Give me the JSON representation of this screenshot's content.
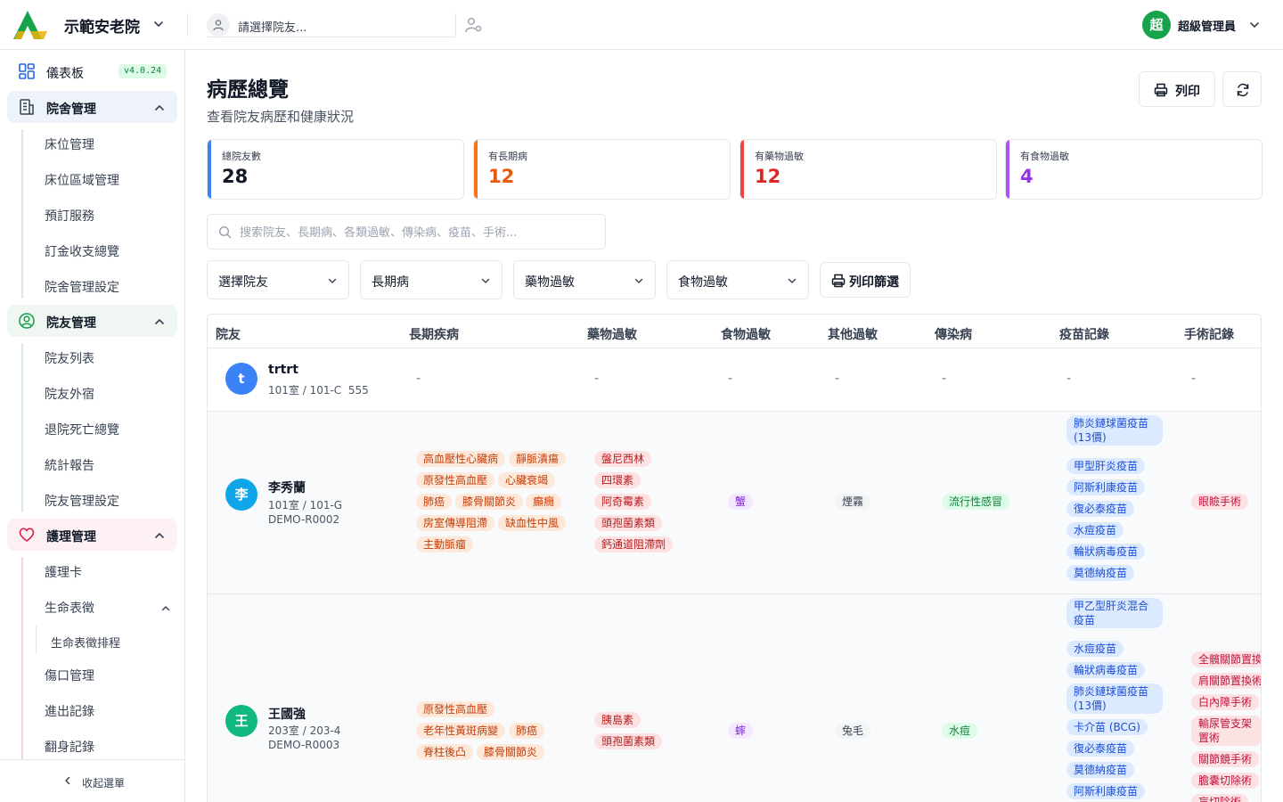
{
  "header": {
    "org_name": "示範安老院",
    "resident_placeholder": "請選擇院友...",
    "user_avatar": "超",
    "user_name": "超級管理員"
  },
  "sidebar": {
    "dashboard": "儀表板",
    "version": "v4.0.24",
    "groups": [
      {
        "label": "院舍管理",
        "items": [
          "床位管理",
          "床位區域管理",
          "預訂服務",
          "訂金收支總覽",
          "院舍管理設定"
        ]
      },
      {
        "label": "院友管理",
        "items": [
          "院友列表",
          "院友外宿",
          "退院死亡總覽",
          "統計報告",
          "院友管理設定"
        ]
      },
      {
        "label": "護理管理",
        "items": [
          "護理卡",
          "生命表徵",
          "生命表徵排程",
          "傷口管理",
          "進出記錄",
          "翻身記錄"
        ]
      }
    ],
    "collapse_label": "收起選單"
  },
  "page": {
    "title": "病歷總覽",
    "subtitle": "查看院友病歷和健康狀況",
    "print_label": "列印"
  },
  "stats": [
    {
      "label": "總院友數",
      "value": "28",
      "color": "#2563eb"
    },
    {
      "label": "有長期病",
      "value": "12",
      "color": "#ea580c"
    },
    {
      "label": "有藥物過敏",
      "value": "12",
      "color": "#dc2626"
    },
    {
      "label": "有食物過敏",
      "value": "4",
      "color": "#9333ea"
    }
  ],
  "search": {
    "placeholder": "搜索院友、長期病、各類過敏、傳染病、疫苗、手術..."
  },
  "filters": [
    "選擇院友",
    "長期病",
    "藥物過敏",
    "食物過敏"
  ],
  "filter_print_label": "列印篩選",
  "table": {
    "columns": [
      "院友",
      "長期疾病",
      "藥物過敏",
      "食物過敏",
      "其他過敏",
      "傳染病",
      "疫苗記錄",
      "手術記錄"
    ],
    "empty": "-",
    "rows": [
      {
        "avatar": "t",
        "avatar_color": "#3b82f6",
        "name": "trtrt",
        "room": "101室 / 101-C",
        "code": "555"
      },
      {
        "avatar": "李",
        "avatar_color": "#0ea5e9",
        "name": "李秀蘭",
        "room": "101室 / 101-G",
        "code": "DEMO-R0002",
        "chronic": [
          "高血壓性心臟病",
          "靜脈潰瘍",
          "原發性高血壓",
          "心臟衰竭",
          "肺癌",
          "膝骨關節炎",
          "癲癇",
          "房室傳導阻滯",
          "缺血性中風",
          "主動脈瘤"
        ],
        "drug": [
          "盤尼西林",
          "四環素",
          "阿奇霉素",
          "頭孢菌素類",
          "鈣通道阻滯劑"
        ],
        "food": [
          "蟹"
        ],
        "other": [
          "煙霧"
        ],
        "infectious": [
          "流行性感冒"
        ],
        "vaccines": [
          "肺炎鏈球菌疫苗(13價)",
          "甲型肝炎疫苗",
          "阿斯利康疫苗",
          "復必泰疫苗",
          "水痘疫苗",
          "輪狀病毒疫苗",
          "莫德納疫苗"
        ],
        "surgery": [
          "眼瞼手術"
        ]
      },
      {
        "avatar": "王",
        "avatar_color": "#10b981",
        "name": "王國強",
        "room": "203室 / 203-4",
        "code": "DEMO-R0003",
        "chronic": [
          "原發性高血壓",
          "老年性黃斑病變",
          "肺癌",
          "脊柱後凸",
          "膝骨關節炎"
        ],
        "drug": [
          "胰島素",
          "頭孢菌素類"
        ],
        "food": [
          "蟀"
        ],
        "other": [
          "兔毛"
        ],
        "infectious": [
          "水痘"
        ],
        "vaccines": [
          "甲乙型肝炎混合疫苗",
          "水痘疫苗",
          "輪狀病毒疫苗",
          "肺炎鏈球菌疫苗(13價)",
          "卡介苗 (BCG)",
          "復必泰疫苗",
          "莫德納疫苗",
          "阿斯利康疫苗"
        ],
        "surgery": [
          "全髖關節置換",
          "肩關節置換術",
          "白內障手術",
          "輸尿管支架置術",
          "關節鏡手術",
          "膽囊切除術",
          "盲切除術"
        ]
      }
    ]
  }
}
